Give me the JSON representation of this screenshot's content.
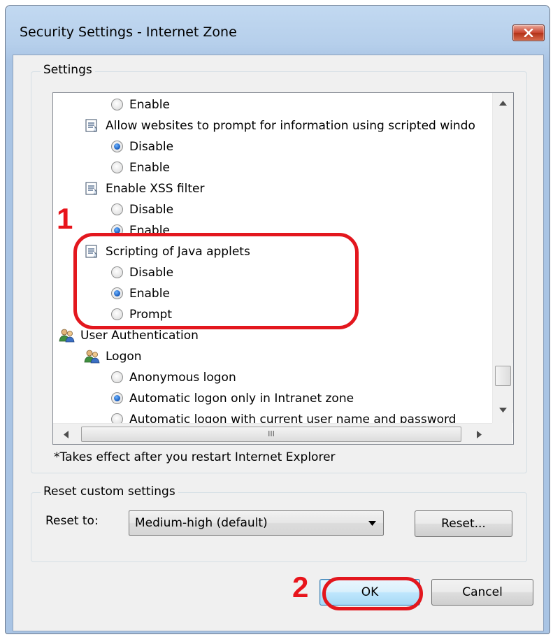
{
  "window": {
    "title": "Security Settings - Internet Zone",
    "close_symbol": "✕"
  },
  "settings_group": {
    "label": "Settings",
    "rows": [
      {
        "kind": "radio",
        "label": "Enable",
        "checked": false
      },
      {
        "kind": "setting",
        "label": "Allow websites to prompt for information using scripted windo",
        "icon": "script-settings-icon"
      },
      {
        "kind": "radio",
        "label": "Disable",
        "checked": true
      },
      {
        "kind": "radio",
        "label": "Enable",
        "checked": false
      },
      {
        "kind": "setting",
        "label": "Enable XSS filter",
        "icon": "script-settings-icon"
      },
      {
        "kind": "radio",
        "label": "Disable",
        "checked": false
      },
      {
        "kind": "radio",
        "label": "Enable",
        "checked": true
      },
      {
        "kind": "setting",
        "label": "Scripting of Java applets",
        "icon": "script-settings-icon"
      },
      {
        "kind": "radio",
        "label": "Disable",
        "checked": false
      },
      {
        "kind": "radio",
        "label": "Enable",
        "checked": true
      },
      {
        "kind": "radio",
        "label": "Prompt",
        "checked": false
      },
      {
        "kind": "category",
        "label": "User Authentication",
        "icon": "users-icon"
      },
      {
        "kind": "subcategory",
        "label": "Logon",
        "icon": "users-icon"
      },
      {
        "kind": "radio",
        "label": "Anonymous logon",
        "checked": false
      },
      {
        "kind": "radio",
        "label": "Automatic logon only in Intranet zone",
        "checked": true
      },
      {
        "kind": "radio",
        "label": "Automatic logon with current user name and password",
        "checked": false
      }
    ],
    "scrollbar_grip": "III",
    "footnote": "*Takes effect after you restart Internet Explorer"
  },
  "reset_group": {
    "label": "Reset custom settings",
    "reset_to_label": "Reset to:",
    "selected_option": "Medium-high (default)",
    "reset_button": "Reset..."
  },
  "buttons": {
    "ok": "OK",
    "cancel": "Cancel"
  },
  "annotations": {
    "step1": "1",
    "step2": "2",
    "color": "#e3171e"
  }
}
